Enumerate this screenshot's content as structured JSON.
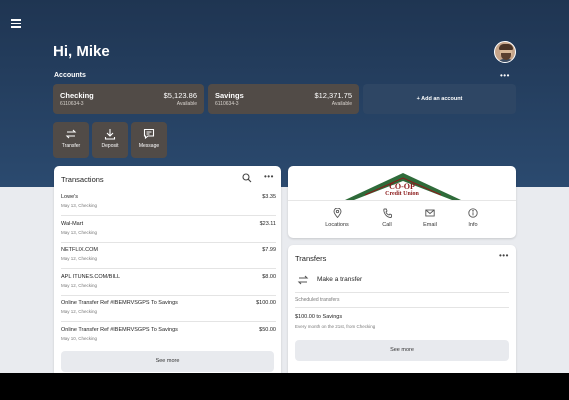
{
  "header": {
    "greeting": "Hi, Mike",
    "menu_icon": "hamburger-icon",
    "avatar_icon": "user-avatar"
  },
  "accounts": {
    "section_label": "Accounts",
    "more_icon": "more-horizontal-icon",
    "items": [
      {
        "name": "Checking",
        "number": "6110634-3",
        "balance": "$5,123.86",
        "balance_label": "Available"
      },
      {
        "name": "Savings",
        "number": "6110634-3",
        "balance": "$12,371.75",
        "balance_label": "Available"
      }
    ],
    "add_label": "+ Add an account"
  },
  "actions": [
    {
      "label": "Transfer",
      "icon": "transfer-icon"
    },
    {
      "label": "Deposit",
      "icon": "download-icon"
    },
    {
      "label": "Message",
      "icon": "message-icon"
    }
  ],
  "transactions": {
    "title": "Transactions",
    "search_icon": "search-icon",
    "more_icon": "more-horizontal-icon",
    "rows": [
      {
        "desc": "Lowe's",
        "sub": "May 13, Checking",
        "amount": "$3.35"
      },
      {
        "desc": "Wal-Mart",
        "sub": "May 13, Checking",
        "amount": "$23.11"
      },
      {
        "desc": "NETFLIX.COM",
        "sub": "May 12, Checking",
        "amount": "$7.99"
      },
      {
        "desc": "APL ITUNES.COM/BILL",
        "sub": "May 12, Checking",
        "amount": "$8.00"
      },
      {
        "desc": "Online Transfer Ref #IBEMRVSGPS To Savings",
        "sub": "May 12, Checking",
        "amount": "$100.00"
      },
      {
        "desc": "Online Transfer Ref #IBEMRVSGPS To Savings",
        "sub": "May 10, Checking",
        "amount": "$50.00"
      }
    ],
    "see_more": "See more"
  },
  "credit_union": {
    "logo_line1": "CO-OP",
    "logo_line2": "Credit Union",
    "brand_color": "#8b1a1a",
    "roof_color": "#2f6b3a",
    "links": [
      {
        "label": "Locations",
        "icon": "location-pin-icon"
      },
      {
        "label": "Call",
        "icon": "phone-icon"
      },
      {
        "label": "Email",
        "icon": "mail-icon"
      },
      {
        "label": "Info",
        "icon": "info-icon"
      }
    ]
  },
  "transfers": {
    "title": "Transfers",
    "more_icon": "more-horizontal-icon",
    "make_label": "Make a transfer",
    "make_icon": "transfer-icon",
    "scheduled_label": "Scheduled transfers",
    "scheduled": [
      {
        "desc": "$100.00 to Savings",
        "sub": "Every month on the 21st, from Checking"
      }
    ],
    "see_more": "See more"
  }
}
